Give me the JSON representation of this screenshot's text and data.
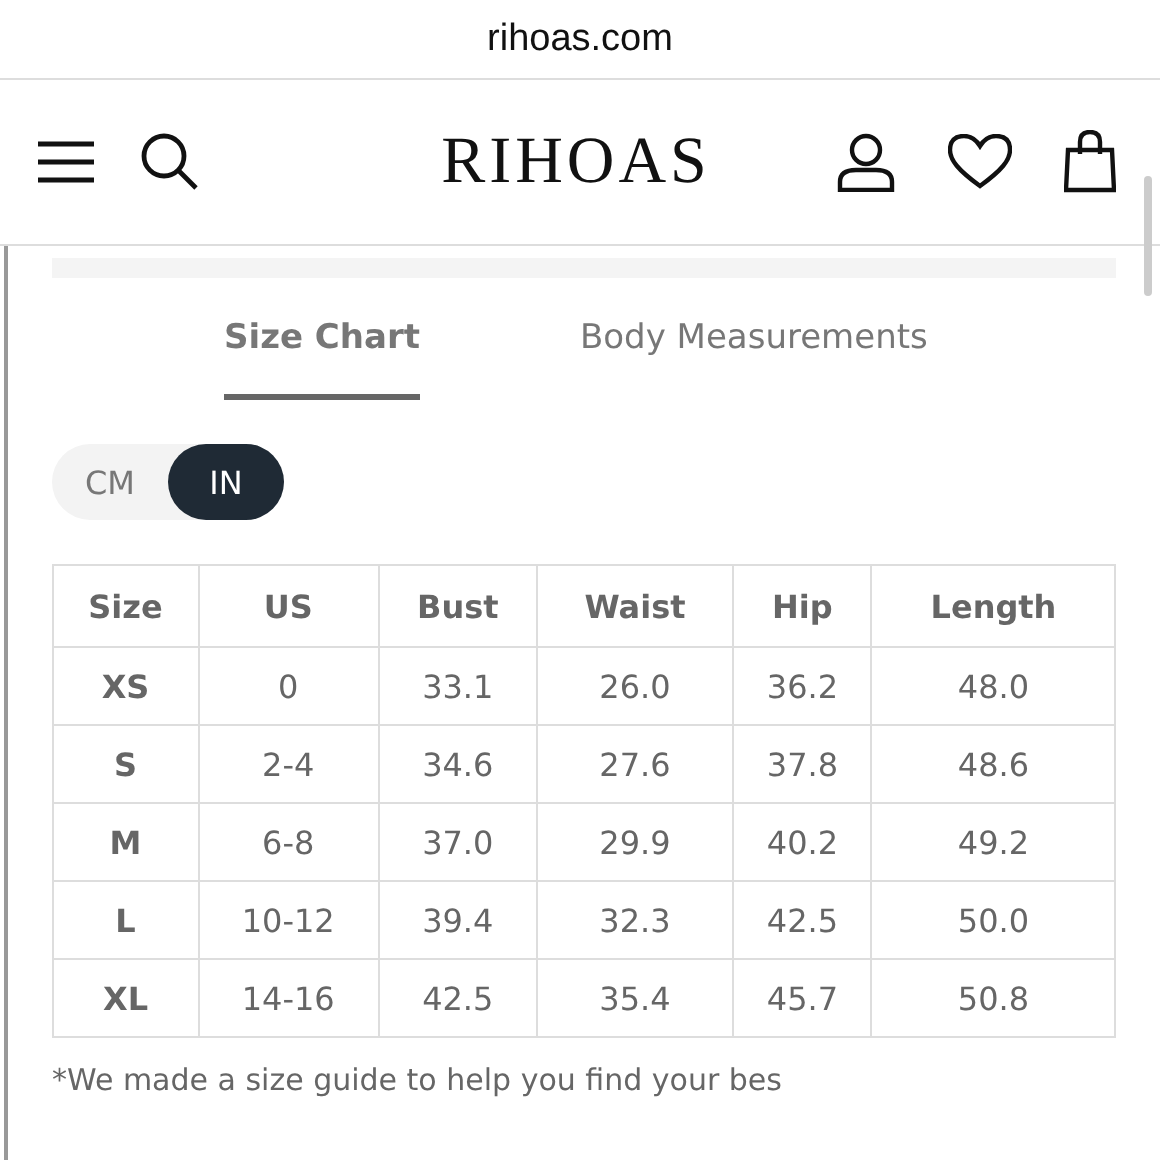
{
  "browser": {
    "url": "rihoas.com"
  },
  "header": {
    "logo": "RIHOAS"
  },
  "tabs": [
    {
      "label": "Size Chart",
      "selected": true
    },
    {
      "label": "Body Measurements",
      "selected": false
    }
  ],
  "units": [
    {
      "label": "CM",
      "selected": false
    },
    {
      "label": "IN",
      "selected": true
    }
  ],
  "table": {
    "columns": [
      "Size",
      "US",
      "Bust",
      "Waist",
      "Hip",
      "Length"
    ],
    "rows": [
      [
        "XS",
        "0",
        "33.1",
        "26.0",
        "36.2",
        "48.0"
      ],
      [
        "S",
        "2-4",
        "34.6",
        "27.6",
        "37.8",
        "48.6"
      ],
      [
        "M",
        "6-8",
        "37.0",
        "29.9",
        "40.2",
        "49.2"
      ],
      [
        "L",
        "10-12",
        "39.4",
        "32.3",
        "42.5",
        "50.0"
      ],
      [
        "XL",
        "14-16",
        "42.5",
        "35.4",
        "45.7",
        "50.8"
      ]
    ]
  },
  "note": "*We made a size guide to help you find your bes"
}
